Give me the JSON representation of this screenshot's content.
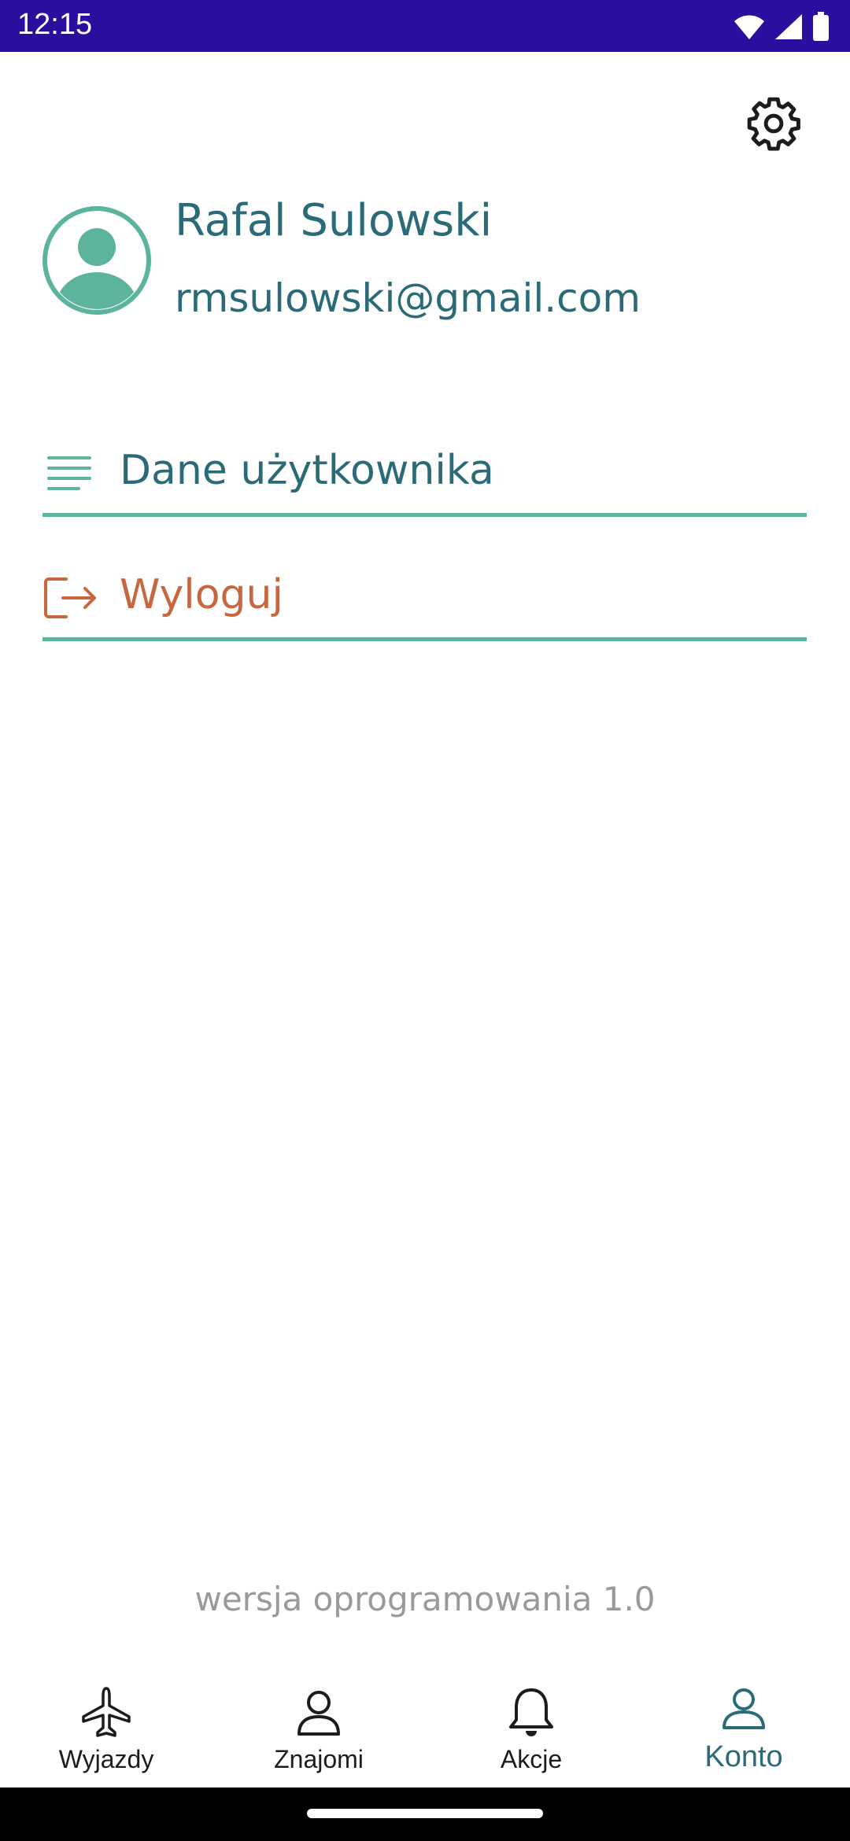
{
  "status_bar": {
    "time": "12:15",
    "icons": [
      "wifi-icon",
      "signal-icon",
      "battery-icon"
    ],
    "background": "#2a0f9e"
  },
  "header": {
    "settings_icon": "gear-icon"
  },
  "profile": {
    "name": "Rafal Sulowski",
    "email": "rmsulowski@gmail.com",
    "avatar_icon": "user-avatar-icon"
  },
  "menu": {
    "items": [
      {
        "label": "Dane użytkownika",
        "icon": "list-lines-icon"
      },
      {
        "label": "Wyloguj",
        "icon": "logout-icon"
      }
    ]
  },
  "footer": {
    "version": "wersja oprogramowania 1.0"
  },
  "bottom_nav": {
    "items": [
      {
        "label": "Wyjazdy",
        "icon": "airplane-icon",
        "active": false
      },
      {
        "label": "Znajomi",
        "icon": "person-icon",
        "active": false
      },
      {
        "label": "Akcje",
        "icon": "bell-icon",
        "active": false
      },
      {
        "label": "Konto",
        "icon": "account-icon",
        "active": true
      }
    ]
  },
  "colors": {
    "primary_text": "#2b6b78",
    "accent_line": "#5cb39e",
    "logout": "#c8673f",
    "muted": "#9a9a9a"
  }
}
